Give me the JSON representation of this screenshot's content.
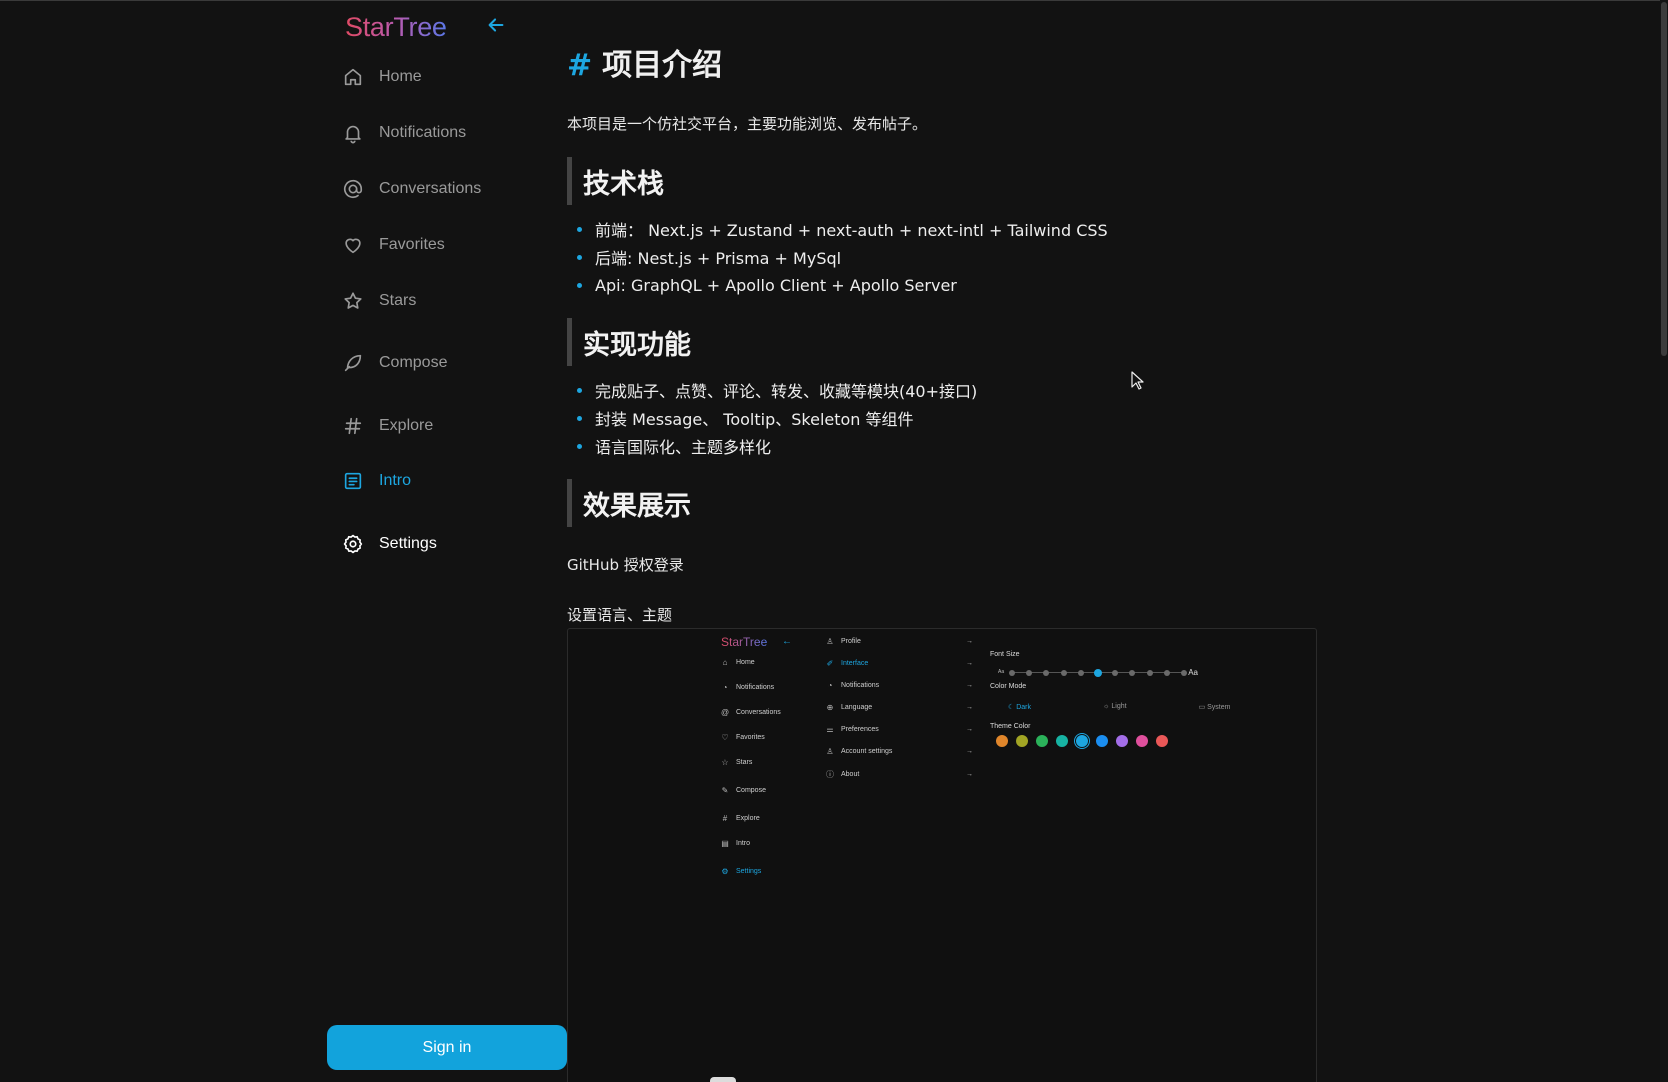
{
  "app": {
    "logo": "StarTree"
  },
  "sidebar": {
    "items": [
      {
        "label": "Home",
        "icon": "home-icon"
      },
      {
        "label": "Notifications",
        "icon": "bell-icon"
      },
      {
        "label": "Conversations",
        "icon": "at-icon"
      },
      {
        "label": "Favorites",
        "icon": "heart-icon"
      },
      {
        "label": "Stars",
        "icon": "star-icon"
      },
      {
        "label": "Compose",
        "icon": "feather-icon"
      },
      {
        "label": "Explore",
        "icon": "hash-icon"
      },
      {
        "label": "Intro",
        "icon": "document-icon",
        "active": true
      },
      {
        "label": "Settings",
        "icon": "gear-icon"
      }
    ],
    "sign_in": "Sign in"
  },
  "content": {
    "title_hash": "#",
    "title": "项目介绍",
    "intro": "本项目是一个仿社交平台，主要功能浏览、发布帖子。",
    "sections": [
      {
        "heading": "技术栈",
        "items": [
          "前端：  Next.js + Zustand + next-auth + next-intl + Tailwind CSS",
          "后端: Nest.js + Prisma + MySql",
          "Api: GraphQL + Apollo Client + Apollo Server"
        ]
      },
      {
        "heading": "实现功能",
        "items": [
          "完成贴子、点赞、评论、转发、收藏等模块(40+接口)",
          "封装 Message、 Tooltip、Skeleton 等组件",
          "语言国际化、主题多样化"
        ]
      },
      {
        "heading": "效果展示"
      }
    ],
    "demo1": "GitHub 授权登录",
    "demo2": "设置语言、主题"
  },
  "screenshot": {
    "logo": "StarTree",
    "nav": [
      "Home",
      "Notifications",
      "Conversations",
      "Favorites",
      "Stars",
      "Compose",
      "Explore",
      "Intro",
      "Settings"
    ],
    "menu": [
      "Profile",
      "Interface",
      "Notifications",
      "Language",
      "Preferences",
      "Account settings",
      "About"
    ],
    "font_size_label": "Font Size",
    "font_small": "Aa",
    "font_large": "Aa",
    "font_size_level": 0.5,
    "color_mode_label": "Color Mode",
    "modes": [
      "Dark",
      "Light",
      "System"
    ],
    "theme_color_label": "Theme Color",
    "theme_colors": [
      "#e0862b",
      "#a2a524",
      "#2bb25a",
      "#17b3a3",
      "#1da6e0",
      "#1b8ef0",
      "#a36ee8",
      "#e0509d",
      "#ea5858"
    ],
    "selected_theme": "#1da6e0"
  },
  "colors": {
    "accent": "#1da6e0",
    "background": "#121212",
    "signin": "#12a3dc"
  }
}
